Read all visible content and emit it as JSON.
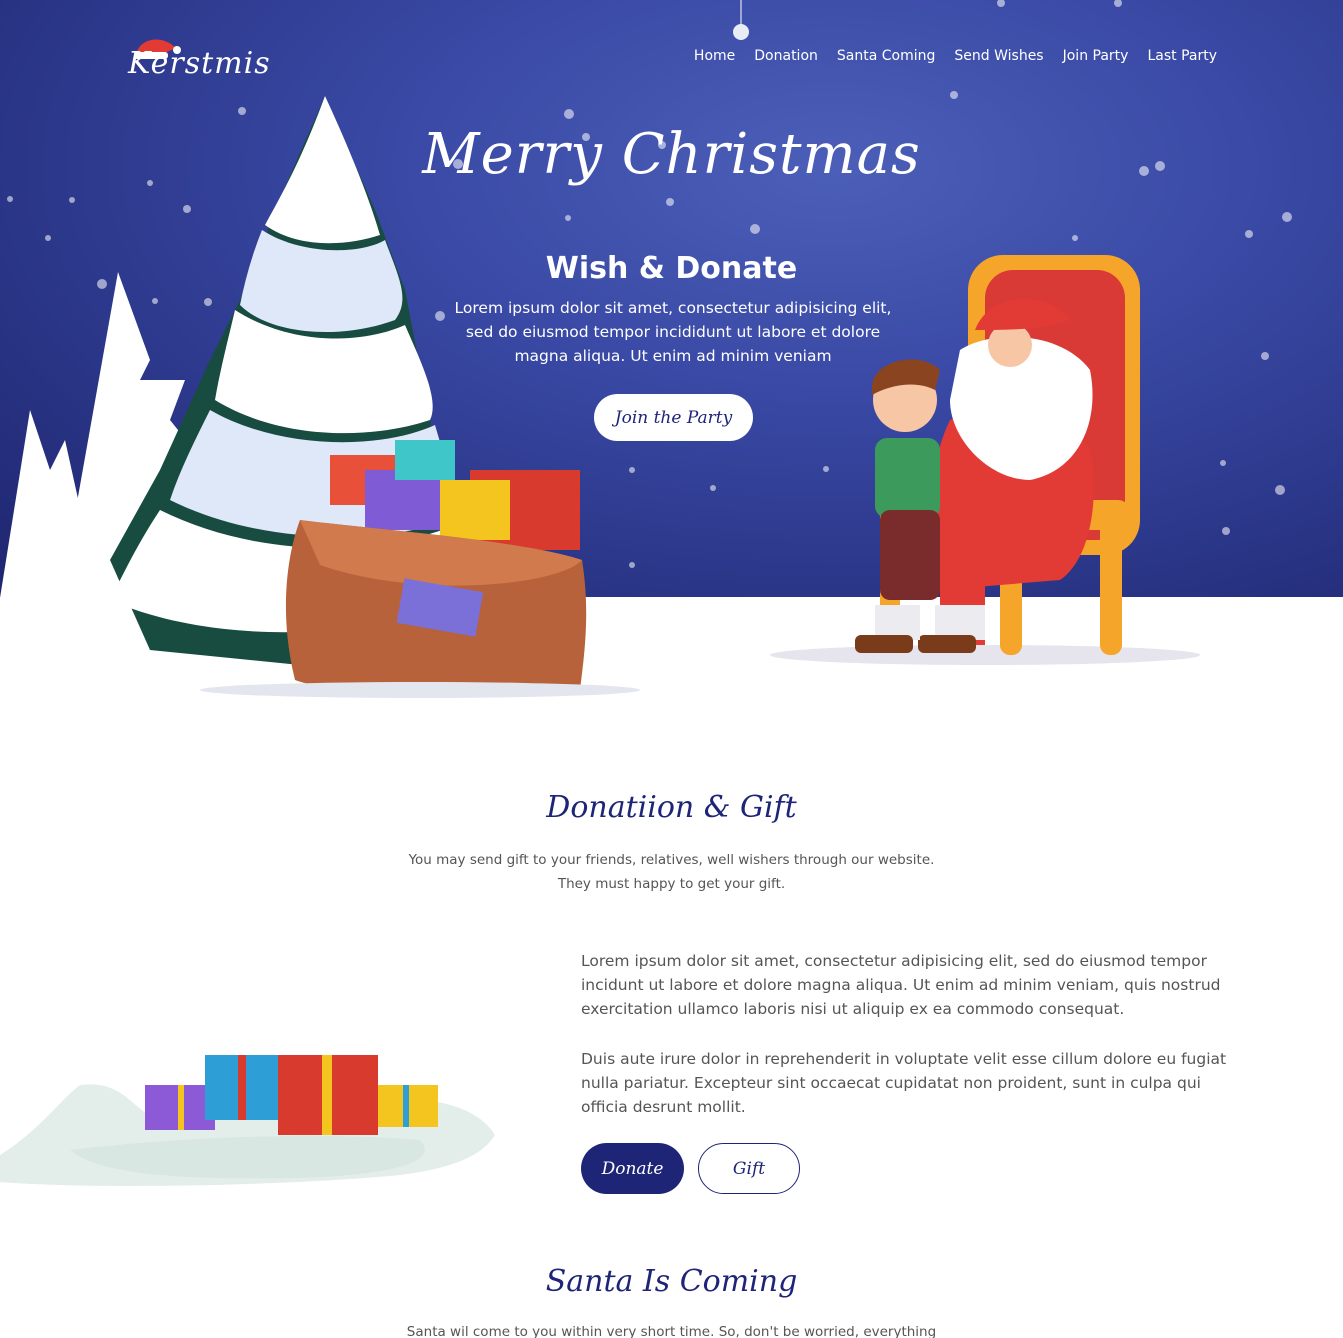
{
  "brand": {
    "logo_text": "Kerstmis"
  },
  "nav": {
    "items": [
      "Home",
      "Donation",
      "Santa Coming",
      "Send Wishes",
      "Join Party",
      "Last Party"
    ]
  },
  "hero": {
    "script_title": "Merry Christmas",
    "title": "Wish & Donate",
    "text": "Lorem ipsum dolor sit amet, consectetur adipisicing elit, sed do eiusmod tempor incididunt ut labore et dolore magna aliqua. Ut enim ad minim veniam",
    "button_label": "Join the Party"
  },
  "donation": {
    "title": "Donatiion & Gift",
    "subtitle_line1": "You may send gift to your friends, relatives, well wishers through our website.",
    "subtitle_line2": "They must happy to get your gift.",
    "paragraph1": "Lorem ipsum dolor sit amet, consectetur adipisicing elit, sed do eiusmod tempor incidunt ut labore et dolore magna aliqua. Ut enim ad minim veniam, quis nostrud exercitation ullamco laboris nisi ut aliquip ex ea commodo consequat.",
    "paragraph2": "Duis aute irure dolor in reprehenderit in voluptate velit esse cillum dolore eu fugiat nulla pariatur. Excepteur sint occaecat cupidatat non proident, sunt in culpa qui officia desrunt mollit.",
    "donate_label": "Donate",
    "gift_label": "Gift"
  },
  "santa_section": {
    "title": "Santa Is Coming",
    "subtitle": "Santa wil come to you within very short time. So, don't be worried, everything"
  },
  "colors": {
    "navy": "#1e2577",
    "sky": "#3a4aa6",
    "white": "#ffffff"
  }
}
